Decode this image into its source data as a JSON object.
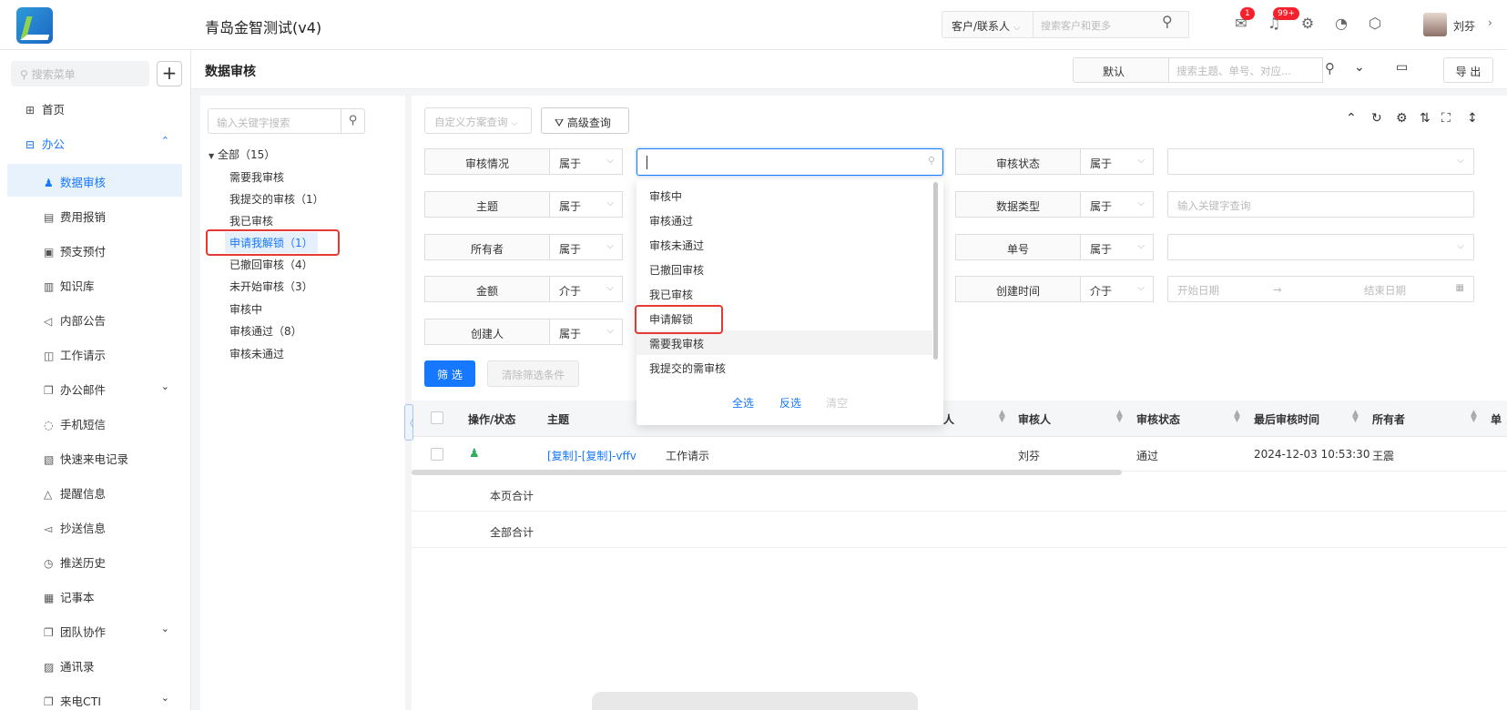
{
  "header": {
    "app_title": "青岛金智测试(v4)",
    "search_scope": "客户/联系人",
    "search_placeholder": "搜索客户和更多",
    "notif_badge_1": "1",
    "notif_badge_2": "99+",
    "user_name": "刘芬"
  },
  "sidebar": {
    "search_placeholder": "搜索菜单",
    "add_label": "+",
    "items": [
      {
        "label": "首页",
        "icon": "home-icon"
      },
      {
        "label": "办公",
        "icon": "office-icon"
      },
      {
        "label": "数据审核",
        "icon": "user-icon"
      },
      {
        "label": "费用报销",
        "icon": "doc-icon"
      },
      {
        "label": "预支预付",
        "icon": "wallet-icon"
      },
      {
        "label": "知识库",
        "icon": "book-icon"
      },
      {
        "label": "内部公告",
        "icon": "megaphone-icon"
      },
      {
        "label": "工作请示",
        "icon": "flag-icon"
      },
      {
        "label": "办公邮件",
        "icon": "mail-icon"
      },
      {
        "label": "手机短信",
        "icon": "chat-icon"
      },
      {
        "label": "快速来电记录",
        "icon": "phone-icon"
      },
      {
        "label": "提醒信息",
        "icon": "bell-icon"
      },
      {
        "label": "抄送信息",
        "icon": "send-icon"
      },
      {
        "label": "推送历史",
        "icon": "clock-icon"
      },
      {
        "label": "记事本",
        "icon": "notebook-icon"
      },
      {
        "label": "团队协作",
        "icon": "team-icon"
      },
      {
        "label": "通讯录",
        "icon": "contacts-icon"
      },
      {
        "label": "来电CTI",
        "icon": "cti-icon"
      }
    ]
  },
  "page": {
    "title": "数据审核",
    "view_select": "默认",
    "search_placeholder": "搜索主题、单号、对应...",
    "export_label": "导 出"
  },
  "tree": {
    "search_placeholder": "输入关键字搜索",
    "root": "全部（15）",
    "items": [
      "需要我审核",
      "我提交的审核（1）",
      "我已审核",
      "申请我解锁（1）",
      "已撤回审核（4）",
      "未开始审核（3）",
      "审核中",
      "审核通过（8）",
      "审核未通过"
    ]
  },
  "toolbar": {
    "scheme_placeholder": "自定义方案查询",
    "advanced_query": "高级查询"
  },
  "filters": {
    "left": [
      {
        "label": "审核情况",
        "op": "属于"
      },
      {
        "label": "主题",
        "op": "属于"
      },
      {
        "label": "所有者",
        "op": "属于"
      },
      {
        "label": "金额",
        "op": "介于"
      },
      {
        "label": "创建人",
        "op": "属于"
      }
    ],
    "right": [
      {
        "label": "审核状态",
        "op": "属于",
        "value": ""
      },
      {
        "label": "数据类型",
        "op": "属于",
        "value": "输入关键字查询"
      },
      {
        "label": "单号",
        "op": "属于",
        "value": ""
      },
      {
        "label": "创建时间",
        "op": "介于",
        "value": ""
      }
    ],
    "date_start": "开始日期",
    "date_arrow": "→",
    "date_end": "结束日期",
    "filter_btn": "筛 选",
    "clear_btn": "清除筛选条件"
  },
  "dropdown": {
    "options": [
      "审核中",
      "审核通过",
      "审核未通过",
      "已撤回审核",
      "我已审核",
      "申请解锁",
      "需要我审核",
      "我提交的需审核"
    ],
    "select_all": "全选",
    "invert": "反选",
    "clear": "清空"
  },
  "table": {
    "columns": [
      "操作/状态",
      "主题",
      "人",
      "审核人",
      "审核状态",
      "最后审核时间",
      "所有者",
      "单"
    ],
    "rows": [
      {
        "subject": "[复制]-[复制]-vffv",
        "type": "工作请示",
        "reviewer": "刘芬",
        "status": "通过",
        "time": "2024-12-03 10:53:30",
        "owner": "王震"
      }
    ],
    "page_total": "本页合计",
    "all_total": "全部合计"
  },
  "colors": {
    "accent": "#1677ff",
    "highlight": "#e53935"
  }
}
